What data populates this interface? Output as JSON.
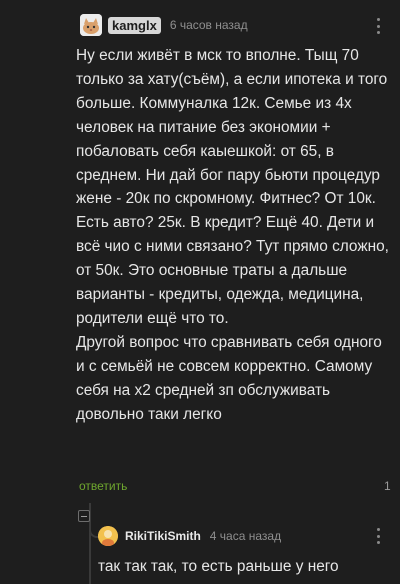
{
  "comment": {
    "username": "kamglx",
    "time": "6 часов назад",
    "text": "Ну если живёт в мск то вполне. Тыщ 70 только за хату(съём), а если ипотека и того больше. Коммуналка 12к. Семье из 4х человек на питание без экономии + побаловать себя каыешкой: от 65, в среднем. Ни дай бог пару бьюти процедур жене - 20к по скромному. Фитнес? От 10к. Есть авто? 25к. В кредит? Ещё 40. Дети и всё чио с ними связано? Тут прямо сложно, от 50к. Это основные траты а дальше варианты - кредиты, одежда, медицина, родители ещё что то.\nДругой вопрос что сравнивать себя одного и с семьёй не совсем корректно. Самому себя на х2 средней зп обслуживать довольно таки легко",
    "reply_label": "ответить",
    "replies_count": "1",
    "avatar_icon": "cat-avatar-icon",
    "menu_icon": "more-vertical-icon"
  },
  "reply": {
    "username": "RikiTikiSmith",
    "time": "4 часа назад",
    "text": "так так так, то есть раньше у него",
    "avatar_icon": "avatar-icon",
    "menu_icon": "more-vertical-icon"
  },
  "colors": {
    "background": "#1e1e1e",
    "reply_green": "#6fa82e",
    "muted": "#8f8f8f"
  }
}
